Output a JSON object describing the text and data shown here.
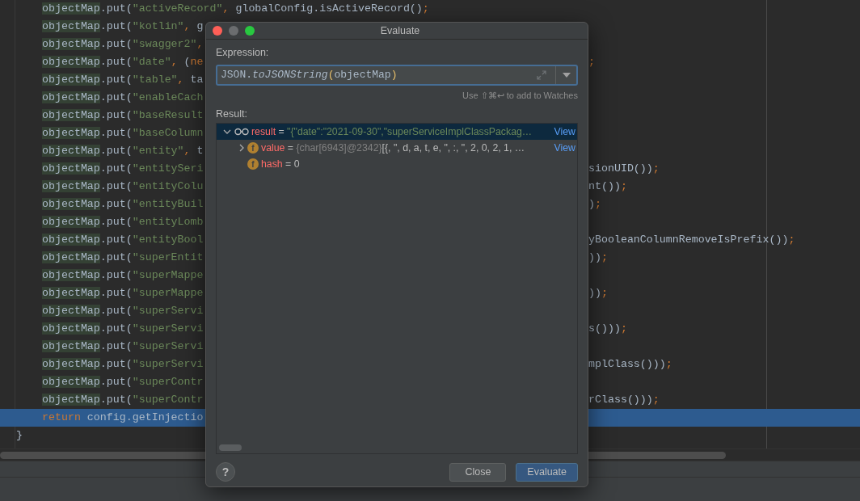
{
  "editor": {
    "lines": [
      {
        "selected": false,
        "kind": "code",
        "left": [
          {
            "kind": "ident",
            "text": "objectMap"
          },
          {
            "kind": "plain",
            "text": ".put("
          },
          {
            "kind": "string",
            "text": "\"activeRecord\""
          },
          {
            "kind": "keyword",
            "text": ","
          },
          {
            "kind": "plain",
            "text": " globalConfig.isActiveRecord()"
          },
          {
            "kind": "keyword",
            "text": ";"
          }
        ]
      },
      {
        "selected": false,
        "kind": "code",
        "left": [
          {
            "kind": "ident",
            "text": "objectMap"
          },
          {
            "kind": "plain",
            "text": ".put("
          },
          {
            "kind": "string",
            "text": "\"kotlin\""
          },
          {
            "kind": "keyword",
            "text": ","
          },
          {
            "kind": "plain",
            "text": " g"
          }
        ]
      },
      {
        "selected": false,
        "kind": "code",
        "left": [
          {
            "kind": "ident",
            "text": "objectMap"
          },
          {
            "kind": "plain",
            "text": ".put("
          },
          {
            "kind": "string",
            "text": "\"swagger2\""
          },
          {
            "kind": "keyword",
            "text": ","
          }
        ]
      },
      {
        "selected": false,
        "kind": "code",
        "left": [
          {
            "kind": "ident",
            "text": "objectMap"
          },
          {
            "kind": "plain",
            "text": ".put("
          },
          {
            "kind": "string",
            "text": "\"date\""
          },
          {
            "kind": "keyword",
            "text": ","
          },
          {
            "kind": "plain",
            "text": " ("
          },
          {
            "kind": "keyword",
            "text": "ne"
          }
        ],
        "right": [
          {
            "kind": "keyword",
            "text": ";"
          }
        ]
      },
      {
        "selected": false,
        "kind": "code",
        "left": [
          {
            "kind": "ident",
            "text": "objectMap"
          },
          {
            "kind": "plain",
            "text": ".put("
          },
          {
            "kind": "string",
            "text": "\"table\""
          },
          {
            "kind": "keyword",
            "text": ","
          },
          {
            "kind": "plain",
            "text": " ta"
          }
        ]
      },
      {
        "selected": false,
        "kind": "code",
        "left": [
          {
            "kind": "ident",
            "text": "objectMap"
          },
          {
            "kind": "plain",
            "text": ".put("
          },
          {
            "kind": "string",
            "text": "\"enableCach"
          }
        ]
      },
      {
        "selected": false,
        "kind": "code",
        "left": [
          {
            "kind": "ident",
            "text": "objectMap"
          },
          {
            "kind": "plain",
            "text": ".put("
          },
          {
            "kind": "string",
            "text": "\"baseResult"
          }
        ]
      },
      {
        "selected": false,
        "kind": "code",
        "left": [
          {
            "kind": "ident",
            "text": "objectMap"
          },
          {
            "kind": "plain",
            "text": ".put("
          },
          {
            "kind": "string",
            "text": "\"baseColumn"
          }
        ]
      },
      {
        "selected": false,
        "kind": "code",
        "left": [
          {
            "kind": "ident",
            "text": "objectMap"
          },
          {
            "kind": "plain",
            "text": ".put("
          },
          {
            "kind": "string",
            "text": "\"entity\""
          },
          {
            "kind": "keyword",
            "text": ","
          },
          {
            "kind": "plain",
            "text": " t"
          }
        ]
      },
      {
        "selected": false,
        "kind": "code",
        "left": [
          {
            "kind": "ident",
            "text": "objectMap"
          },
          {
            "kind": "plain",
            "text": ".put("
          },
          {
            "kind": "string",
            "text": "\"entitySeri"
          }
        ],
        "right": [
          {
            "kind": "plain",
            "text": "sionUID())"
          },
          {
            "kind": "keyword",
            "text": ";"
          }
        ]
      },
      {
        "selected": false,
        "kind": "code",
        "left": [
          {
            "kind": "ident",
            "text": "objectMap"
          },
          {
            "kind": "plain",
            "text": ".put("
          },
          {
            "kind": "string",
            "text": "\"entityColu"
          }
        ],
        "right": [
          {
            "kind": "plain",
            "text": "nt())"
          },
          {
            "kind": "keyword",
            "text": ";"
          }
        ]
      },
      {
        "selected": false,
        "kind": "code",
        "left": [
          {
            "kind": "ident",
            "text": "objectMap"
          },
          {
            "kind": "plain",
            "text": ".put("
          },
          {
            "kind": "string",
            "text": "\"entityBuil"
          }
        ],
        "right": [
          {
            "kind": "plain",
            "text": ")"
          },
          {
            "kind": "keyword",
            "text": ";"
          }
        ]
      },
      {
        "selected": false,
        "kind": "code",
        "left": [
          {
            "kind": "ident",
            "text": "objectMap"
          },
          {
            "kind": "plain",
            "text": ".put("
          },
          {
            "kind": "string",
            "text": "\"entityLomb"
          }
        ]
      },
      {
        "selected": false,
        "kind": "code",
        "left": [
          {
            "kind": "ident",
            "text": "objectMap"
          },
          {
            "kind": "plain",
            "text": ".put("
          },
          {
            "kind": "string",
            "text": "\"entityBool"
          }
        ],
        "right": [
          {
            "kind": "plain",
            "text": "yBooleanColumnRemoveIsPrefix())"
          },
          {
            "kind": "keyword",
            "text": ";"
          }
        ]
      },
      {
        "selected": false,
        "kind": "code",
        "left": [
          {
            "kind": "ident",
            "text": "objectMap"
          },
          {
            "kind": "plain",
            "text": ".put("
          },
          {
            "kind": "string",
            "text": "\"superEntit"
          }
        ],
        "right": [
          {
            "kind": "plain",
            "text": "))"
          },
          {
            "kind": "keyword",
            "text": ";"
          }
        ]
      },
      {
        "selected": false,
        "kind": "code",
        "left": [
          {
            "kind": "ident",
            "text": "objectMap"
          },
          {
            "kind": "plain",
            "text": ".put("
          },
          {
            "kind": "string",
            "text": "\"superMappe"
          }
        ]
      },
      {
        "selected": false,
        "kind": "code",
        "left": [
          {
            "kind": "ident",
            "text": "objectMap"
          },
          {
            "kind": "plain",
            "text": ".put("
          },
          {
            "kind": "string",
            "text": "\"superMappe"
          }
        ],
        "right": [
          {
            "kind": "plain",
            "text": "))"
          },
          {
            "kind": "keyword",
            "text": ";"
          }
        ]
      },
      {
        "selected": false,
        "kind": "code",
        "left": [
          {
            "kind": "ident",
            "text": "objectMap"
          },
          {
            "kind": "plain",
            "text": ".put("
          },
          {
            "kind": "string",
            "text": "\"superServi"
          }
        ]
      },
      {
        "selected": false,
        "kind": "code",
        "left": [
          {
            "kind": "ident",
            "text": "objectMap"
          },
          {
            "kind": "plain",
            "text": ".put("
          },
          {
            "kind": "string",
            "text": "\"superServi"
          }
        ],
        "right": [
          {
            "kind": "plain",
            "text": "s()))"
          },
          {
            "kind": "keyword",
            "text": ";"
          }
        ]
      },
      {
        "selected": false,
        "kind": "code",
        "left": [
          {
            "kind": "ident",
            "text": "objectMap"
          },
          {
            "kind": "plain",
            "text": ".put("
          },
          {
            "kind": "string",
            "text": "\"superServi"
          }
        ]
      },
      {
        "selected": false,
        "kind": "code",
        "left": [
          {
            "kind": "ident",
            "text": "objectMap"
          },
          {
            "kind": "plain",
            "text": ".put("
          },
          {
            "kind": "string",
            "text": "\"superServi"
          }
        ],
        "right": [
          {
            "kind": "plain",
            "text": "mplClass()))"
          },
          {
            "kind": "keyword",
            "text": ";"
          }
        ]
      },
      {
        "selected": false,
        "kind": "code",
        "left": [
          {
            "kind": "ident",
            "text": "objectMap"
          },
          {
            "kind": "plain",
            "text": ".put("
          },
          {
            "kind": "string",
            "text": "\"superContr"
          }
        ]
      },
      {
        "selected": false,
        "kind": "code",
        "left": [
          {
            "kind": "ident",
            "text": "objectMap"
          },
          {
            "kind": "plain",
            "text": ".put("
          },
          {
            "kind": "string",
            "text": "\"superContr"
          }
        ],
        "right": [
          {
            "kind": "plain",
            "text": "rClass()))"
          },
          {
            "kind": "keyword",
            "text": ";"
          }
        ]
      },
      {
        "selected": true,
        "kind": "code",
        "left": [
          {
            "kind": "keyword",
            "text": "return"
          },
          {
            "kind": "plain",
            "text": " config.getInjectio"
          }
        ]
      },
      {
        "selected": false,
        "kind": "closing",
        "left": [
          {
            "kind": "plain",
            "text": "}"
          }
        ]
      }
    ]
  },
  "dialog": {
    "title": "Evaluate",
    "expression_label": "Expression:",
    "expression": [
      {
        "kind": "plain",
        "text": "JSON."
      },
      {
        "kind": "italic",
        "text": "toJSONString"
      },
      {
        "kind": "bracket",
        "text": "("
      },
      {
        "kind": "plain",
        "text": "objectMap"
      },
      {
        "kind": "bracket",
        "text": ")"
      }
    ],
    "hint": "Use ⇧⌘↩ to add to Watches",
    "result_label": "Result:",
    "tree": [
      {
        "kind": "watch",
        "name": "result",
        "sep": "=",
        "expanded": true,
        "selected": true,
        "value": "\"{\"date\":\"2021-09-30\",\"superServiceImplClassPackag…",
        "link": "View",
        "children": [
          {
            "kind": "field",
            "icon_text": "f",
            "name": "value",
            "sep": "=",
            "expanded": false,
            "selected": false,
            "type_info": "{char[6943]@2342}",
            "value": "[{, \", d, a, t, e, \", :, \", 2, 0, 2, 1, …",
            "link": "View"
          },
          {
            "kind": "field",
            "icon_text": "f",
            "name": "hash",
            "sep": "=",
            "selected": false,
            "value": "0"
          }
        ]
      }
    ],
    "help": "?",
    "buttons": [
      {
        "label": "Close",
        "primary": false
      },
      {
        "label": "Evaluate",
        "primary": true
      }
    ]
  }
}
